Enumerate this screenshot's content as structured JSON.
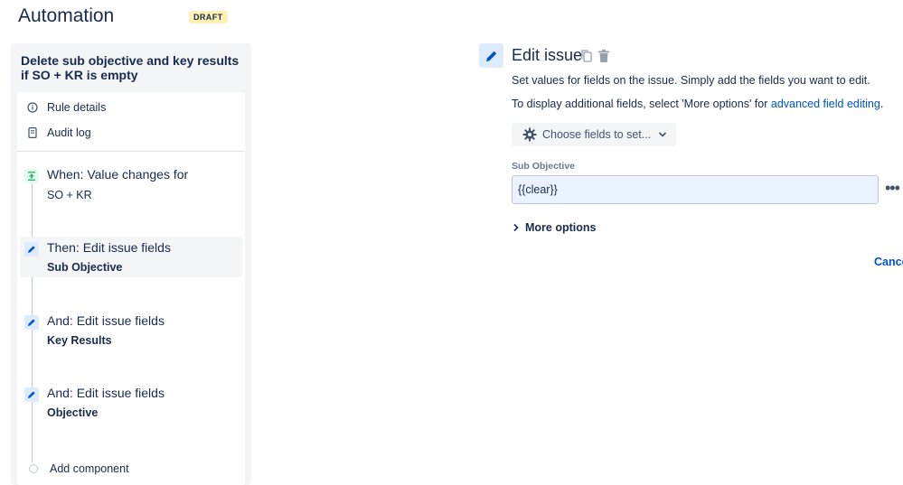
{
  "header": {
    "title": "Automation",
    "status_badge": "DRAFT"
  },
  "rule": {
    "name": "Delete sub objective and key results if SO + KR is empty"
  },
  "menu": {
    "rule_details": "Rule details",
    "audit_log": "Audit log"
  },
  "steps": [
    {
      "title": "When: Value changes for",
      "subtitle": "SO + KR",
      "icon": "trigger-icon",
      "color": "#36b37e"
    },
    {
      "title": "Then: Edit issue fields",
      "subtitle": "Sub Objective",
      "icon": "pencil-icon",
      "color": "#0052cc"
    },
    {
      "title": "And: Edit issue fields",
      "subtitle": "Key Results",
      "icon": "pencil-icon",
      "color": "#0052cc"
    },
    {
      "title": "And: Edit issue fields",
      "subtitle": "Objective",
      "icon": "pencil-icon",
      "color": "#0052cc"
    }
  ],
  "add_component": "Add component",
  "editor": {
    "title": "Edit issue",
    "description": "Set values for fields on the issue. Simply add the fields you want to edit.",
    "advanced_prefix": "To display additional fields, select 'More options' for ",
    "advanced_link": "advanced field editing",
    "advanced_suffix": ".",
    "choose_fields": "Choose fields to set...",
    "field_label": "Sub Objective",
    "field_value": "{{clear}}",
    "more_options": "More options",
    "cancel": "Cancel"
  },
  "colors": {
    "accent": "#0052cc",
    "draft_bg": "#fff0b3",
    "selected_bg": "#deebff"
  }
}
